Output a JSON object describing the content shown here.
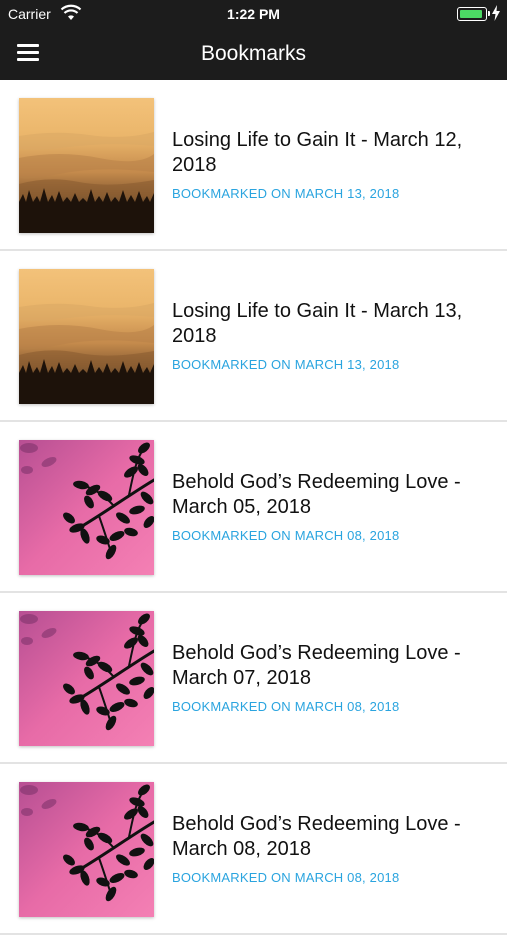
{
  "status_bar": {
    "carrier": "Carrier",
    "time": "1:22 PM",
    "battery_level": 0.9,
    "battery_color": "#4cd964"
  },
  "header": {
    "title": "Bookmarks",
    "menu_icon": "hamburger-menu-icon",
    "background": "#1c1c1c"
  },
  "accent_color": "#2aa4df",
  "bookmarks": [
    {
      "title": "Losing Life to Gain It - March 12, 2018",
      "bookmarked": "BOOKMARKED ON MARCH 13, 2018",
      "image": "misty-sunrise-forest"
    },
    {
      "title": "Losing Life to Gain It - March 13, 2018",
      "bookmarked": "BOOKMARKED ON MARCH 13, 2018",
      "image": "misty-sunrise-forest"
    },
    {
      "title": "Behold God’s Redeeming Love - March 05, 2018",
      "bookmarked": "BOOKMARKED ON MARCH 08, 2018",
      "image": "pink-sky-leaves"
    },
    {
      "title": "Behold God’s Redeeming Love - March 07, 2018",
      "bookmarked": "BOOKMARKED ON MARCH 08, 2018",
      "image": "pink-sky-leaves"
    },
    {
      "title": "Behold God’s Redeeming Love - March 08, 2018",
      "bookmarked": "BOOKMARKED ON MARCH 08, 2018",
      "image": "pink-sky-leaves"
    }
  ]
}
